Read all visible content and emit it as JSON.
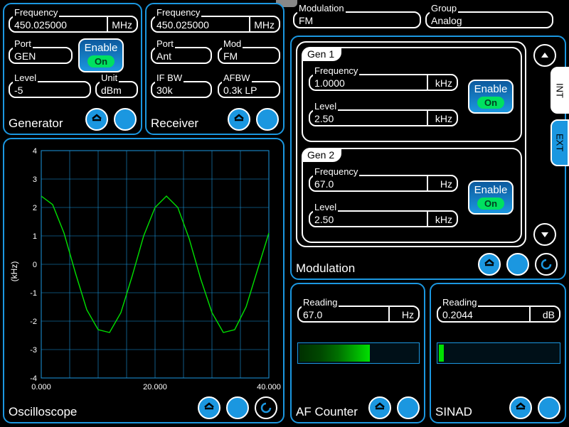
{
  "generator": {
    "title": "Generator",
    "frequency": {
      "label": "Frequency",
      "value": "450.025000",
      "unit": "MHz"
    },
    "port": {
      "label": "Port",
      "value": "GEN"
    },
    "level": {
      "label": "Level",
      "value": "-5"
    },
    "unit": {
      "label": "Unit",
      "value": "dBm"
    },
    "enable": {
      "label": "Enable",
      "state": "On"
    }
  },
  "receiver": {
    "title": "Receiver",
    "frequency": {
      "label": "Frequency",
      "value": "450.025000",
      "unit": "MHz"
    },
    "port": {
      "label": "Port",
      "value": "Ant"
    },
    "mod": {
      "label": "Mod",
      "value": "FM"
    },
    "ifbw": {
      "label": "IF BW",
      "value": "30k"
    },
    "afbw": {
      "label": "AFBW",
      "value": "0.3k LP"
    }
  },
  "top": {
    "modulation": {
      "label": "Modulation",
      "value": "FM"
    },
    "group": {
      "label": "Group",
      "value": "Analog"
    }
  },
  "modulation": {
    "title": "Modulation",
    "gen1": {
      "tab": "Gen 1",
      "frequency": {
        "label": "Frequency",
        "value": "1.0000",
        "unit": "kHz"
      },
      "level": {
        "label": "Level",
        "value": "2.50",
        "unit": "kHz"
      },
      "enable": {
        "label": "Enable",
        "state": "On"
      }
    },
    "gen2": {
      "tab": "Gen 2",
      "frequency": {
        "label": "Frequency",
        "value": "67.0",
        "unit": "Hz"
      },
      "level": {
        "label": "Level",
        "value": "2.50",
        "unit": "kHz"
      },
      "enable": {
        "label": "Enable",
        "state": "On"
      }
    }
  },
  "side": {
    "int": "INT",
    "ext": "EXT"
  },
  "oscilloscope": {
    "title": "Oscilloscope",
    "ylabel": "(kHz)",
    "xticks": [
      "0.000",
      "20.000",
      "40.000"
    ],
    "yticks": [
      "-4",
      "-3",
      "-2",
      "-1",
      "0",
      "1",
      "2",
      "3",
      "4"
    ]
  },
  "afcounter": {
    "title": "AF Counter",
    "reading": {
      "label": "Reading",
      "value": "67.0",
      "unit": "Hz"
    }
  },
  "sinad": {
    "title": "SINAD",
    "reading": {
      "label": "Reading",
      "value": "0.2044",
      "unit": "dB"
    }
  },
  "chart_data": {
    "type": "line",
    "title": "",
    "xlabel": "",
    "ylabel": "(kHz)",
    "xlim": [
      0,
      40
    ],
    "ylim": [
      -4,
      4
    ],
    "xticks": [
      0,
      20,
      40
    ],
    "yticks": [
      -4,
      -3,
      -2,
      -1,
      0,
      1,
      2,
      3,
      4
    ],
    "description": "Sinusoid, amplitude ≈ 2.4 kHz, ≈ 2.5 cycles over 0–40 time units",
    "series": [
      {
        "name": "waveform",
        "x": [
          0,
          2,
          4,
          6,
          8,
          10,
          12,
          14,
          16,
          18,
          20,
          22,
          24,
          26,
          28,
          30,
          32,
          34,
          36,
          38,
          40
        ],
        "y": [
          2.4,
          2.1,
          1.1,
          -0.3,
          -1.6,
          -2.3,
          -2.4,
          -1.7,
          -0.4,
          1.0,
          2.0,
          2.4,
          2.0,
          0.9,
          -0.5,
          -1.7,
          -2.4,
          -2.3,
          -1.5,
          -0.2,
          1.1
        ]
      }
    ]
  }
}
